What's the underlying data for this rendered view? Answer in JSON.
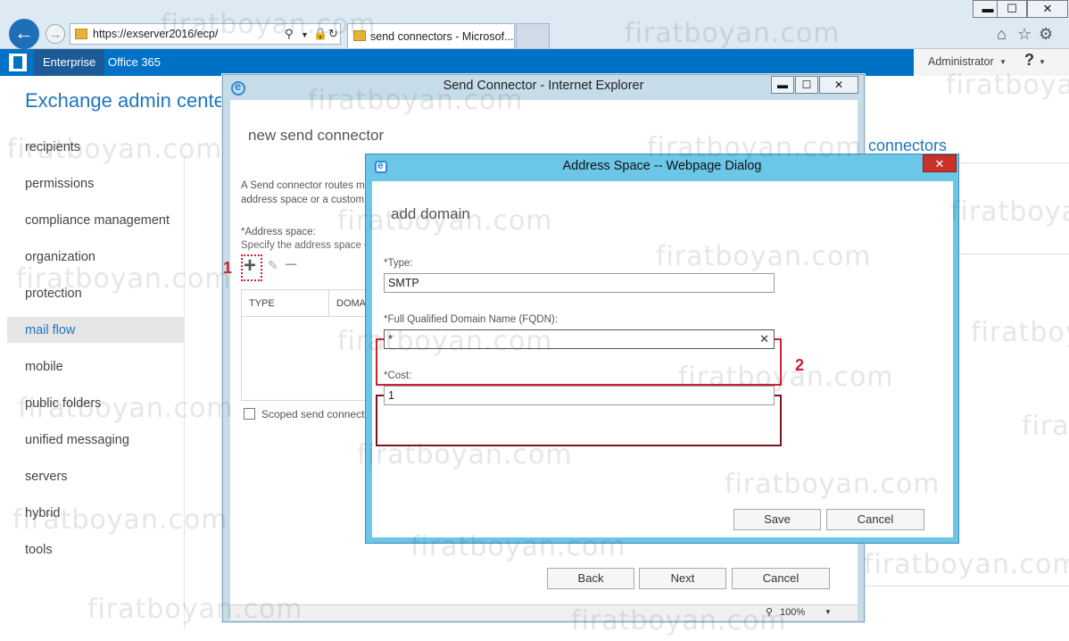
{
  "browser": {
    "url": "https://exserver2016/ecp/",
    "tab_title": "send connectors - Microsof...",
    "window_controls": {
      "minimize": "▬",
      "maximize": "☐",
      "close": "✕"
    },
    "icons": [
      "back-arrow-icon",
      "forward-arrow-icon",
      "search-icon",
      "lock-icon",
      "refresh-icon",
      "home-icon",
      "favorites-star-icon",
      "settings-gear-icon"
    ]
  },
  "eac_header": {
    "enterprise": "Enterprise",
    "office365": "Office 365",
    "admin": "Administrator",
    "help": "?"
  },
  "eac": {
    "title": "Exchange admin center",
    "nav": [
      "recipients",
      "permissions",
      "compliance management",
      "organization",
      "protection",
      "mail flow",
      "mobile",
      "public folders",
      "unified messaging",
      "servers",
      "hybrid",
      "tools"
    ],
    "selected": "mail flow",
    "right_title": "connectors"
  },
  "send_connector": {
    "window_title": "Send Connector - Internet Explorer",
    "heading": "new send connector",
    "desc_line1": "A Send connector routes m",
    "desc_line2": "address space or a custom",
    "address_space_label": "*Address space:",
    "address_space_help": "Specify the address space o",
    "annotation_1": "1",
    "table_headers": [
      "TYPE",
      "DOMA"
    ],
    "scoped_label": "Scoped send connecto",
    "buttons": {
      "back": "Back",
      "next": "Next",
      "cancel": "Cancel"
    },
    "zoom": "100%"
  },
  "address_dialog": {
    "title": "Address Space -- Webpage Dialog",
    "close": "✕",
    "heading": "add domain",
    "type_label": "*Type:",
    "type_value": "SMTP",
    "fqdn_label": "*Full Qualified Domain Name (FQDN):",
    "fqdn_value": "*",
    "cost_label": "*Cost:",
    "cost_value": "1",
    "annotation_2": "2",
    "buttons": {
      "save": "Save",
      "cancel": "Cancel"
    }
  },
  "watermark": "firatboyan.com",
  "colors": {
    "eac_blue": "#0072c6",
    "link_blue": "#1e76c0",
    "dialog_frame": "#6bc6e8",
    "annotation_red": "#d0202e",
    "annotation_dark_red": "#7a1420"
  }
}
